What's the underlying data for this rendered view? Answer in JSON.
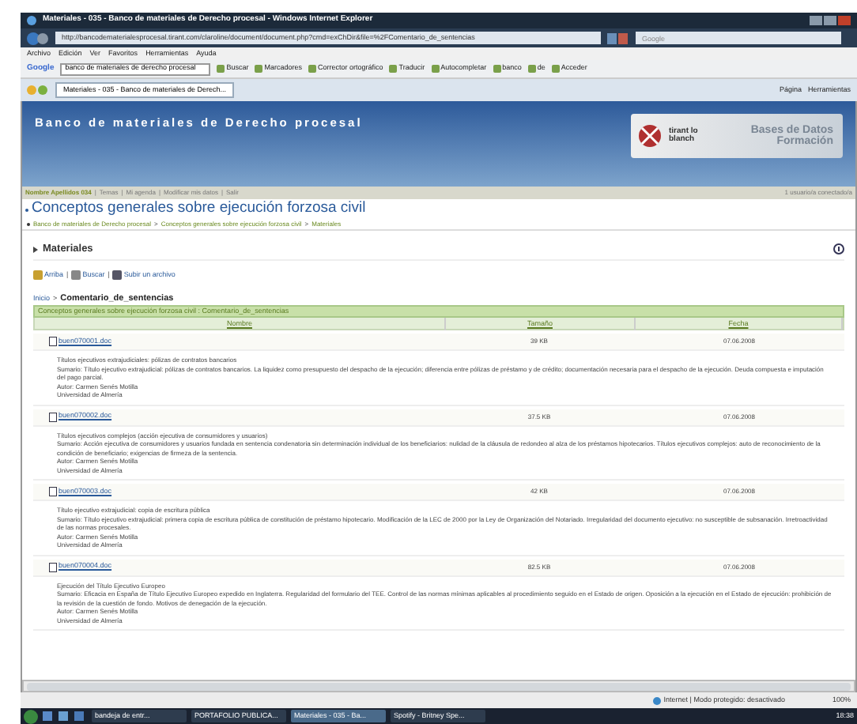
{
  "window": {
    "title": "Materiales - 035 - Banco de materiales de Derecho procesal - Windows Internet Explorer"
  },
  "address_bar": {
    "url": "http://bancodematerialesprocesal.tirant.com/claroline/document/document.php?cmd=exChDir&file=%2FComentario_de_sentencias",
    "search_placeholder": "Google"
  },
  "menu": [
    "Archivo",
    "Edición",
    "Ver",
    "Favoritos",
    "Herramientas",
    "Ayuda"
  ],
  "google_toolbar": {
    "logo": "Google",
    "query": "banco de materiales de derecho procesal",
    "items": [
      "Buscar",
      "Marcadores",
      "Corrector ortográfico",
      "Traducir",
      "Autocompletar",
      "banco",
      "de",
      "Acceder"
    ]
  },
  "tab": {
    "label": "Materiales - 035 - Banco de materiales de Derech...",
    "tools": [
      "Página",
      "Herramientas"
    ]
  },
  "banner": {
    "title": "Banco de materiales de Derecho procesal",
    "logo_text": "tirant lo blanch",
    "logo_tagline": "Bases de Datos Formación"
  },
  "user_bar": {
    "links": [
      "Nombre Apellidos 034",
      "Temas",
      "Mi agenda",
      "Modificar mis datos",
      "Salir"
    ],
    "separator": "|",
    "online": "1 usuario/a conectado/a"
  },
  "page_title": "Conceptos generales sobre ejecución forzosa civil",
  "breadcrumb_separator": ">",
  "breadcrumb": [
    "Banco de materiales de Derecho procesal",
    "Conceptos generales sobre ejecución forzosa civil",
    "Materiales"
  ],
  "section": {
    "title": "Materiales",
    "actions": [
      "Arriba",
      "Buscar",
      "Subir un archivo"
    ],
    "action_separator": "|",
    "path_home": "Inicio",
    "path_separator": ">",
    "path_current": "Comentario_de_sentencias"
  },
  "table": {
    "caption": "Conceptos generales sobre ejecución forzosa civil : Comentario_de_sentencias",
    "columns": [
      "Nombre",
      "Tamaño",
      "Fecha"
    ],
    "rows": [
      {
        "name": "buen070001.doc",
        "size": "39 KB",
        "date": "07.06.2008",
        "lines": [
          "Títulos ejecutivos extrajudiciales: pólizas de contratos bancarios",
          "Sumario: Título ejecutivo extrajudicial: pólizas de contratos bancarios. La liquidez como presupuesto del despacho de la ejecución; diferencia entre pólizas de préstamo y de crédito; documentación necesaria para el despacho de la ejecución. Deuda compuesta e imputación del pago parcial.",
          "Autor: Carmen Senés Motilla",
          "Universidad de Almería"
        ]
      },
      {
        "name": "buen070002.doc",
        "size": "37.5 KB",
        "date": "07.06.2008",
        "lines": [
          "Títulos ejecutivos complejos (acción ejecutiva de consumidores y usuarios)",
          "Sumario: Acción ejecutiva de consumidores y usuarios fundada en sentencia condenatoria sin determinación individual de los beneficiarios: nulidad de la cláusula de redondeo al alza de los préstamos hipotecarios. Títulos ejecutivos complejos: auto de reconocimiento de la condición de beneficiario; exigencias de firmeza de la sentencia.",
          "Autor: Carmen Senés Motilla",
          "Universidad de Almería"
        ]
      },
      {
        "name": "buen070003.doc",
        "size": "42 KB",
        "date": "07.06.2008",
        "lines": [
          "Título ejecutivo extrajudicial: copia de escritura pública",
          "Sumario: Título ejecutivo extrajudicial: primera copia de escritura pública de constitución de préstamo hipotecario. Modificación de la LEC de 2000 por la Ley de Organización del Notariado. Irregularidad del documento ejecutivo: no susceptible de subsanación. Irretroactividad de las normas procesales.",
          "Autor: Carmen Senés Motilla",
          "Universidad de Almería"
        ]
      },
      {
        "name": "buen070004.doc",
        "size": "82.5 KB",
        "date": "07.06.2008",
        "lines": [
          "Ejecución del Título Ejecutivo Europeo",
          "Sumario: Eficacia en España de Título Ejecutivo Europeo expedido en Inglaterra. Regularidad del formulario del TEE. Control de las normas mínimas aplicables al procedimiento seguido en el Estado de origen. Oposición a la ejecución en el Estado de ejecución: prohibición de la revisión de la cuestión de fondo. Motivos de denegación de la ejecución.",
          "Autor: Carmen Senés Motilla",
          "Universidad de Almería"
        ]
      }
    ]
  },
  "status_bar": {
    "zone": "Internet | Modo protegido: desactivado",
    "zoom": "100%"
  },
  "taskbar": {
    "items": [
      {
        "label": "bandeja de entr...",
        "selected": false
      },
      {
        "label": "PORTAFOLIO PUBLICA...",
        "selected": false
      },
      {
        "label": "Materiales - 035 - Ba...",
        "selected": true
      },
      {
        "label": "Spotify - Britney Spe...",
        "selected": false
      }
    ],
    "clock": "18:38"
  }
}
